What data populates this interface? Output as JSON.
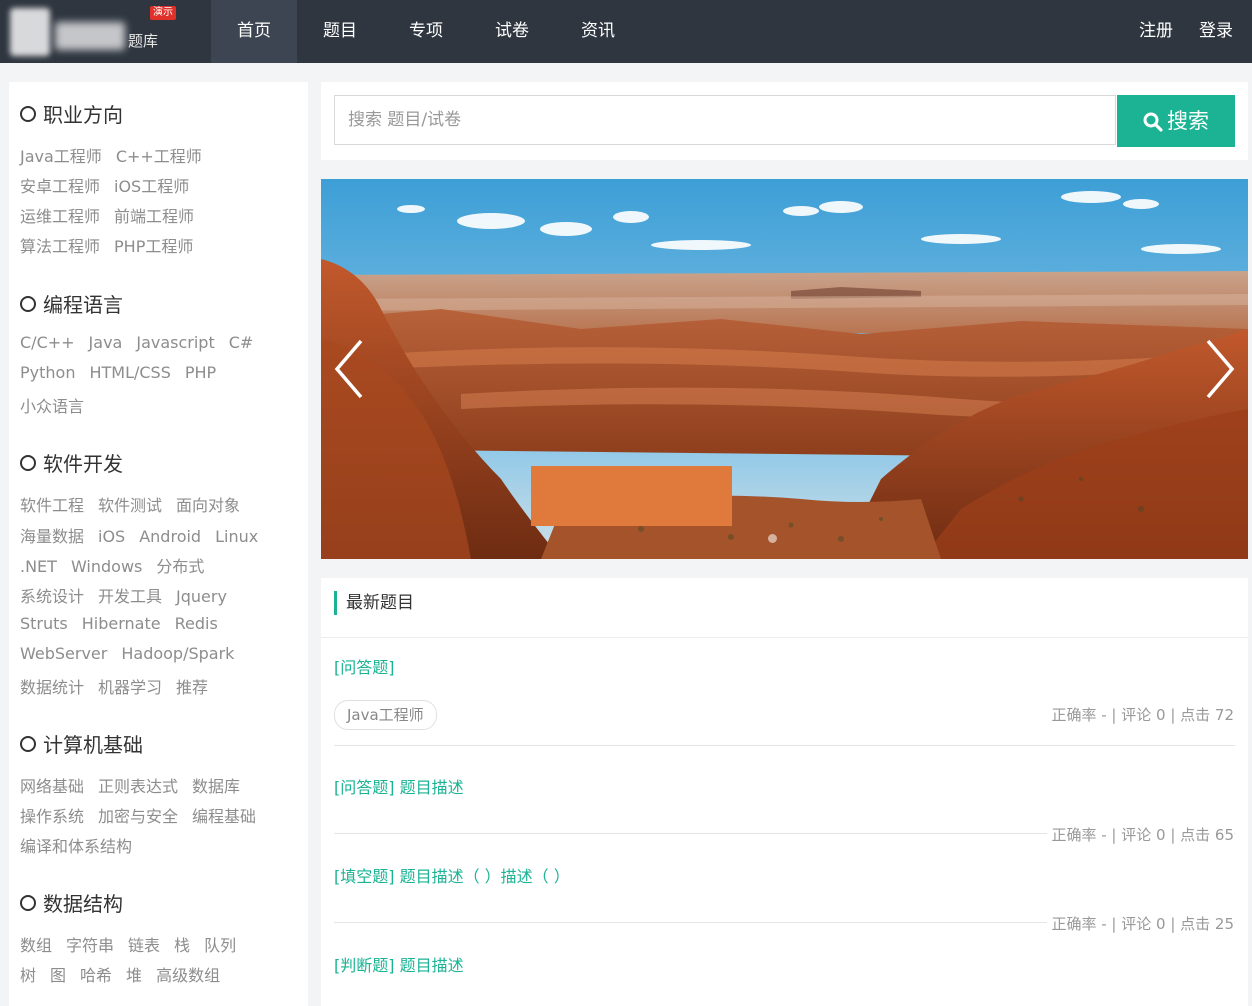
{
  "nav": {
    "brand_badge": "演示",
    "brand_name": "题库",
    "items": [
      "首页",
      "题目",
      "专项",
      "试卷",
      "资讯"
    ],
    "register": "注册",
    "login": "登录"
  },
  "sidebar": {
    "sections": [
      {
        "title": "职业方向",
        "rows": [
          [
            "Java工程师",
            "C++工程师"
          ],
          [
            "安卓工程师",
            "iOS工程师"
          ],
          [
            "运维工程师",
            "前端工程师"
          ],
          [
            "算法工程师",
            "PHP工程师"
          ]
        ]
      },
      {
        "title": "编程语言",
        "rows": [
          [
            "C/C++",
            "Java",
            "Javascript",
            "C#"
          ],
          [
            "Python",
            "HTML/CSS",
            "PHP"
          ],
          [
            "小众语言"
          ]
        ]
      },
      {
        "title": "软件开发",
        "rows": [
          [
            "软件工程",
            "软件测试",
            "面向对象"
          ],
          [
            "海量数据",
            "iOS",
            "Android",
            "Linux"
          ],
          [
            ".NET",
            "Windows",
            "分布式"
          ],
          [
            "系统设计",
            "开发工具",
            "Jquery"
          ],
          [
            "Struts",
            "Hibernate",
            "Redis"
          ],
          [
            "WebServer",
            "Hadoop/Spark"
          ],
          [
            "数据统计",
            "机器学习",
            "推荐"
          ]
        ]
      },
      {
        "title": "计算机基础",
        "rows": [
          [
            "网络基础",
            "正则表达式",
            "数据库"
          ],
          [
            "操作系统",
            "加密与安全",
            "编程基础"
          ],
          [
            "编译和体系结构"
          ]
        ]
      },
      {
        "title": "数据结构",
        "rows": [
          [
            "数组",
            "字符串",
            "链表",
            "栈",
            "队列"
          ],
          [
            "树",
            "图",
            "哈希",
            "堆",
            "高级数组"
          ]
        ]
      }
    ]
  },
  "search": {
    "placeholder": "搜索 题目/试卷",
    "button_label": "搜索"
  },
  "latest": {
    "title": "最新题目",
    "questions": [
      {
        "link": "[问答题]",
        "tag": "Java工程师",
        "meta": "正确率 - | 评论 0 | 点击 72"
      },
      {
        "link": "[问答题] 题目描述",
        "meta": "正确率 - | 评论 0 | 点击 65"
      },
      {
        "link": "[填空题] 题目描述（ ）描述（ ）",
        "meta": "正确率 - | 评论 0 | 点击 25"
      },
      {
        "link": "[判断题] 题目描述"
      }
    ]
  },
  "colors": {
    "accent": "#1bb394",
    "navbar": "#2f3640",
    "badge": "#e0302a"
  }
}
